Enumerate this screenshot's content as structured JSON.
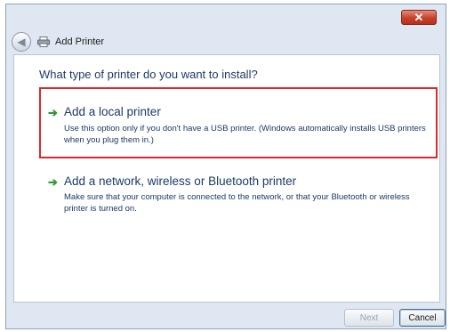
{
  "window": {
    "title": "Add Printer",
    "close_glyph": "✕"
  },
  "nav": {
    "back_glyph": "◀"
  },
  "dialog": {
    "heading": "What type of printer do you want to install?",
    "options": [
      {
        "title": "Add a local printer",
        "description": "Use this option only if you don't have a USB printer. (Windows automatically installs USB printers when you plug them in.)",
        "icon": "green-arrow-icon",
        "selected": true
      },
      {
        "title": "Add a network, wireless or Bluetooth printer",
        "description": "Make sure that your computer is connected to the network, or that your Bluetooth or wireless printer is turned on.",
        "icon": "green-arrow-icon",
        "selected": false
      }
    ],
    "arrow_glyph": "➔"
  },
  "footer": {
    "next_label": "Next",
    "cancel_label": "Cancel"
  },
  "colors": {
    "highlight_border": "#e0282c",
    "link_text": "#1c3a66",
    "arrow_green": "#2f9a37"
  }
}
